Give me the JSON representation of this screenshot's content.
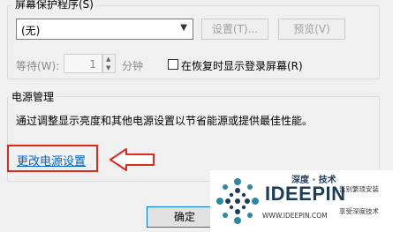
{
  "screensaver": {
    "group_title": "屏幕保护程序(S)",
    "select_value": "(无)",
    "settings_label": "设置(T)...",
    "preview_label": "预览(V)",
    "wait_label": "等待(W):",
    "wait_value": "1",
    "minutes_label": "分钟",
    "resume_checkbox_label": "在恢复时显示登录屏幕(R)"
  },
  "power": {
    "group_title": "电源管理",
    "description": "通过调整显示亮度和其他电源设置以节省能源或提供最佳性能。",
    "link_label": "更改电源设置"
  },
  "footer": {
    "ok_label": "确定"
  },
  "watermark": {
    "top_text": "深度 · 技术",
    "brand": "IDEEPIN",
    "domain": "WWW.IDEEPIN.COM",
    "tagline1": "告别繁琐安装",
    "tagline2": "享受深度技术"
  },
  "colors": {
    "link": "#0066cc",
    "highlight": "#e0281f",
    "brand_dark": "#1c3d5a",
    "brand_teal": "#2b8aa0"
  }
}
